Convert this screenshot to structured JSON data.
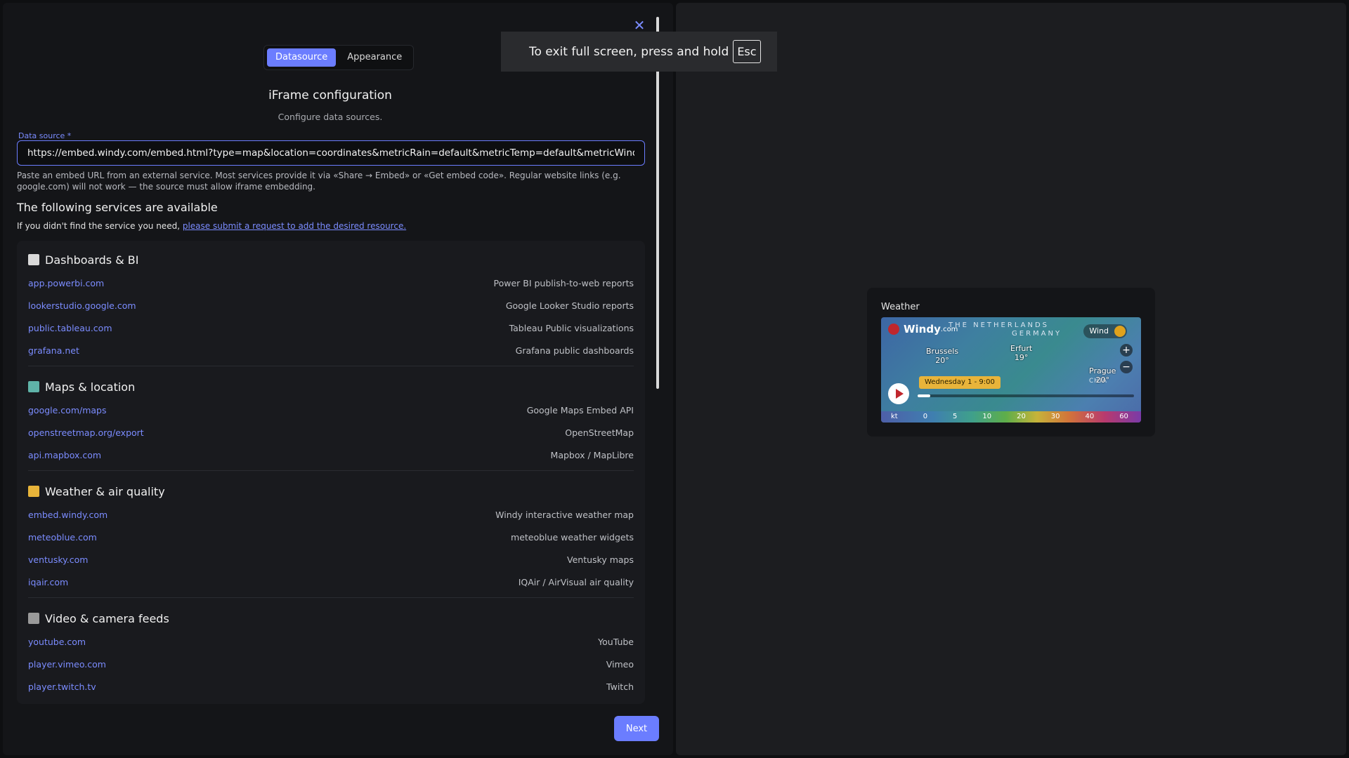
{
  "tabs": [
    {
      "label": "Datasource",
      "active": true
    },
    {
      "label": "Appearance",
      "active": false
    }
  ],
  "header": {
    "title": "iFrame configuration",
    "subtitle": "Configure data sources."
  },
  "datasource": {
    "label": "Data source *",
    "value": "https://embed.windy.com/embed.html?type=map&location=coordinates&metricRain=default&metricTemp=default&metricWind=default&",
    "hint": "Paste an embed URL from an external service. Most services provide it via «Share → Embed» or «Get embed code». Regular website links (e.g. google.com) will not work — the source must allow iframe embedding."
  },
  "available": {
    "title": "The following services are available",
    "request_prefix": "If you didn't find the service you need, ",
    "request_link": "please submit a request to add the desired resource."
  },
  "categories": [
    {
      "name": "Dashboards & BI",
      "icon": "bar-chart-icon",
      "icon_color": "#d9d9d9",
      "items": [
        {
          "domain": "app.powerbi.com",
          "desc": "Power BI publish-to-web reports"
        },
        {
          "domain": "lookerstudio.google.com",
          "desc": "Google Looker Studio reports"
        },
        {
          "domain": "public.tableau.com",
          "desc": "Tableau Public visualizations"
        },
        {
          "domain": "grafana.net",
          "desc": "Grafana public dashboards"
        }
      ]
    },
    {
      "name": "Maps & location",
      "icon": "map-icon",
      "icon_color": "#5fb3a8",
      "items": [
        {
          "domain": "google.com/maps",
          "desc": "Google Maps Embed API"
        },
        {
          "domain": "openstreetmap.org/export",
          "desc": "OpenStreetMap"
        },
        {
          "domain": "api.mapbox.com",
          "desc": "Mapbox / MapLibre"
        }
      ]
    },
    {
      "name": "Weather & air quality",
      "icon": "sun-cloud-icon",
      "icon_color": "#e8b43a",
      "items": [
        {
          "domain": "embed.windy.com",
          "desc": "Windy interactive weather map"
        },
        {
          "domain": "meteoblue.com",
          "desc": "meteoblue weather widgets"
        },
        {
          "domain": "ventusky.com",
          "desc": "Ventusky maps"
        },
        {
          "domain": "iqair.com",
          "desc": "IQAir / AirVisual air quality"
        }
      ]
    },
    {
      "name": "Video & camera feeds",
      "icon": "video-camera-icon",
      "icon_color": "#9a9a9a",
      "items": [
        {
          "domain": "youtube.com",
          "desc": "YouTube"
        },
        {
          "domain": "player.vimeo.com",
          "desc": "Vimeo"
        },
        {
          "domain": "player.twitch.tv",
          "desc": "Twitch"
        }
      ]
    }
  ],
  "footer": {
    "next_label": "Next"
  },
  "preview": {
    "widget_title": "Weather",
    "map": {
      "brand": "Windy",
      "brand_suffix": ".com",
      "wind_label": "Wind",
      "time_label": "Wednesday 1 - 9:00",
      "timeline_progress": 0.06,
      "cities": [
        {
          "name": "Brussels",
          "temp": "20°"
        },
        {
          "name": "Erfurt",
          "temp": "19°"
        },
        {
          "name": "Prague",
          "temp": "20°"
        }
      ],
      "countries": [
        "THE NETHERLANDS",
        "GERMANY",
        "CHIA"
      ],
      "scale_unit": "kt",
      "scale_ticks": [
        "0",
        "5",
        "10",
        "20",
        "30",
        "40",
        "60"
      ]
    }
  },
  "toast": {
    "text": "To exit full screen, press and hold",
    "key": "Esc"
  }
}
